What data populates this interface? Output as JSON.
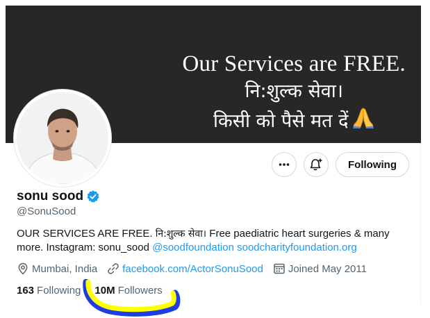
{
  "banner": {
    "line1": "Our Services are FREE.",
    "line2": "नि:शुल्क सेवा।",
    "line3": "किसी को पैसे मत दें"
  },
  "profile": {
    "display_name": "sonu sood",
    "handle": "@SonuSood",
    "bio": {
      "text": "OUR SERVICES ARE FREE. ",
      "hindi": "नि:शुल्क सेवा।",
      "text2": " Free paediatric heart surgeries & many more.  Instagram: sonu_sood ",
      "mention": "@soodfoundation",
      "url": "soodcharityfoundation.org"
    },
    "location": "Mumbai, India",
    "website": "facebook.com/ActorSonuSood",
    "joined": "Joined May 2011",
    "following_count": "163",
    "following_label": "Following",
    "followers_count": "10M",
    "followers_label": "Followers"
  },
  "actions": {
    "follow_label": "Following"
  },
  "icons": {
    "more": "more-icon",
    "notify": "bell-plus-icon",
    "verified": "verified-badge-icon",
    "location": "location-pin-icon",
    "link": "link-icon",
    "calendar": "calendar-icon",
    "pray": "folded-hands-emoji"
  },
  "colors": {
    "accent": "#1d9bf0",
    "banner_bg": "#272727",
    "highlight_yellow": "#ffff00",
    "highlight_blue": "#1d3fe0"
  }
}
